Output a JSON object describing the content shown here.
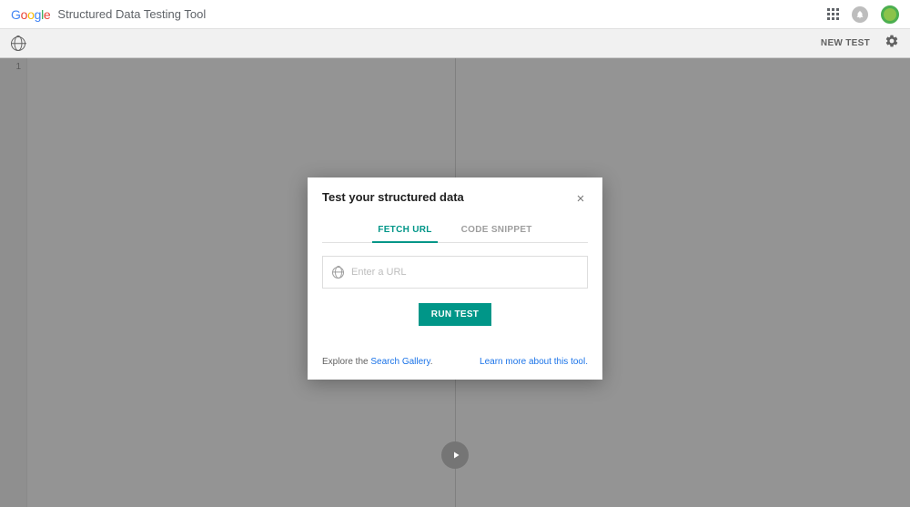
{
  "header": {
    "app_title": "Structured Data Testing Tool"
  },
  "toolbar": {
    "new_test_label": "NEW TEST"
  },
  "editor": {
    "line_number": "1"
  },
  "modal": {
    "title": "Test your structured data",
    "tabs": {
      "fetch_url": "FETCH URL",
      "code_snippet": "CODE SNIPPET"
    },
    "url_placeholder": "Enter a URL",
    "run_button": "RUN TEST",
    "footer": {
      "explore_prefix": "Explore the ",
      "explore_link": "Search Gallery",
      "explore_suffix": ".",
      "learn_more": "Learn more about this tool."
    }
  }
}
